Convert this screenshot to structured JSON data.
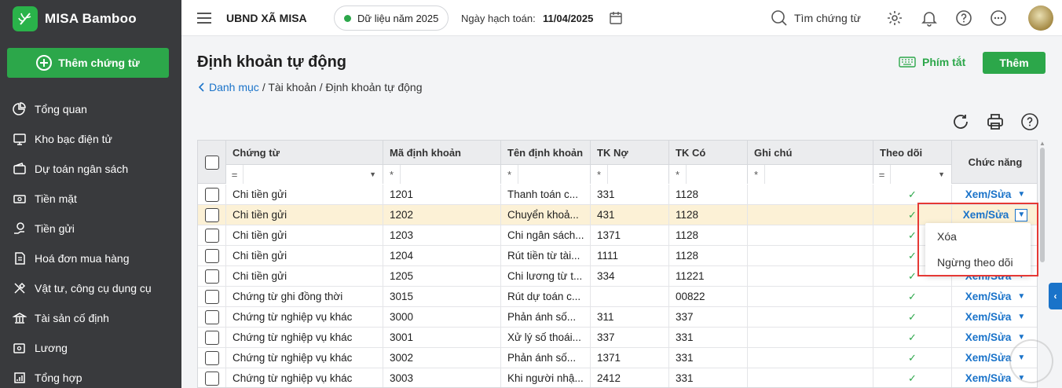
{
  "brand": {
    "name": "MISA Bamboo"
  },
  "sidebar": {
    "add_label": "Thêm chứng từ",
    "items": [
      {
        "label": "Tổng quan"
      },
      {
        "label": "Kho bạc điện tử"
      },
      {
        "label": "Dự toán ngân sách"
      },
      {
        "label": "Tiền mặt"
      },
      {
        "label": "Tiền gửi"
      },
      {
        "label": "Hoá đơn mua hàng"
      },
      {
        "label": "Vật tư, công cụ dụng cụ"
      },
      {
        "label": "Tài sản cố định"
      },
      {
        "label": "Lương"
      },
      {
        "label": "Tổng hợp"
      }
    ]
  },
  "topbar": {
    "org": "UBND XÃ MISA",
    "year": "Dữ liệu năm 2025",
    "post_label": "Ngày hạch toán:",
    "post_date": "11/04/2025",
    "search": "Tìm chứng từ"
  },
  "page": {
    "title": "Định khoản tự động",
    "crumb_link": "Danh mục",
    "crumb_rest": "/ Tài khoản / Định khoản tự động",
    "shortcut": "Phím tắt",
    "add": "Thêm"
  },
  "table": {
    "headers": {
      "doc": "Chứng từ",
      "code": "Mã định khoản",
      "name": "Tên định khoản",
      "debit": "TK Nợ",
      "credit": "TK Có",
      "note": "Ghi chú",
      "track": "Theo dõi",
      "func": "Chức năng"
    },
    "filters": {
      "eq": "=",
      "star": "*"
    },
    "view_label": "Xem/Sửa",
    "check": "✓",
    "rows": [
      {
        "doc": "Chi tiền gửi",
        "code": "1201",
        "name": "Thanh toán c...",
        "debit": "331",
        "credit": "1128",
        "note": ""
      },
      {
        "doc": "Chi tiền gửi",
        "code": "1202",
        "name": "Chuyển khoả...",
        "debit": "431",
        "credit": "1128",
        "note": ""
      },
      {
        "doc": "Chi tiền gửi",
        "code": "1203",
        "name": "Chi ngân sách...",
        "debit": "1371",
        "credit": "1128",
        "note": ""
      },
      {
        "doc": "Chi tiền gửi",
        "code": "1204",
        "name": "Rút tiền từ tài...",
        "debit": "1111",
        "credit": "1128",
        "note": ""
      },
      {
        "doc": "Chi tiền gửi",
        "code": "1205",
        "name": "Chi lương từ t...",
        "debit": "334",
        "credit": "11221",
        "note": ""
      },
      {
        "doc": "Chứng từ ghi đồng thời",
        "code": "3015",
        "name": "Rút dự toán c...",
        "debit": "",
        "credit": "00822",
        "note": ""
      },
      {
        "doc": "Chứng từ nghiệp vụ khác",
        "code": "3000",
        "name": "Phản ánh số...",
        "debit": "311",
        "credit": "337",
        "note": ""
      },
      {
        "doc": "Chứng từ nghiệp vụ khác",
        "code": "3001",
        "name": "Xử lý số thoái...",
        "debit": "337",
        "credit": "331",
        "note": ""
      },
      {
        "doc": "Chứng từ nghiệp vụ khác",
        "code": "3002",
        "name": "Phản ánh số...",
        "debit": "1371",
        "credit": "331",
        "note": ""
      },
      {
        "doc": "Chứng từ nghiệp vụ khác",
        "code": "3003",
        "name": "Khi người nhậ...",
        "debit": "2412",
        "credit": "331",
        "note": ""
      }
    ]
  },
  "dropdown": {
    "items": [
      {
        "label": "Xóa"
      },
      {
        "label": "Ngừng theo dõi"
      }
    ]
  },
  "colors": {
    "brand": "#2ca74a",
    "link": "#1a73c9",
    "highlight": "#e53935",
    "selected_row": "#fcf1d6"
  },
  "icons": [
    "bamboo-logo-icon",
    "plus-circle-icon",
    "pie-chart-icon",
    "monitor-icon",
    "wallet-icon",
    "cash-icon",
    "coin-hand-icon",
    "invoice-icon",
    "tools-icon",
    "bank-icon",
    "salary-icon",
    "summary-icon",
    "menu-icon",
    "calendar-icon",
    "search-icon",
    "gear-icon",
    "bell-icon",
    "help-icon",
    "more-icon",
    "keyboard-icon",
    "refresh-icon",
    "print-icon",
    "chevron-left-icon"
  ]
}
